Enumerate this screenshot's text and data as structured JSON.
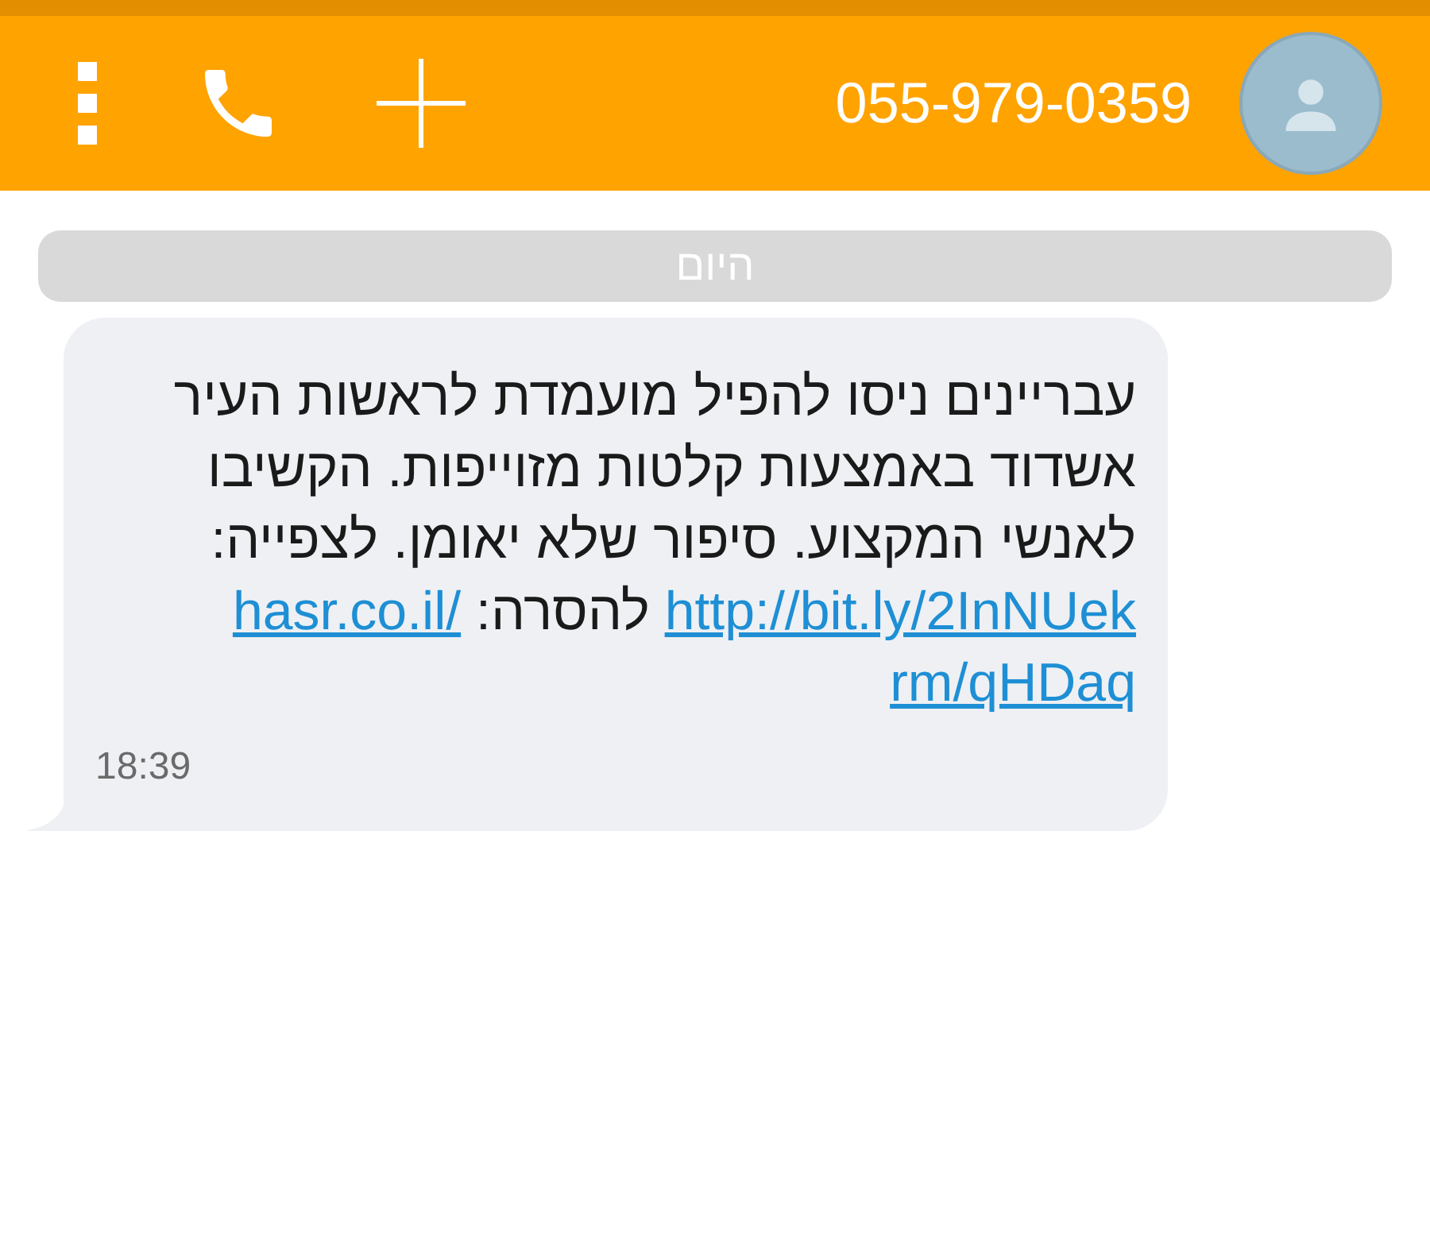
{
  "header": {
    "contact": "055-979-0359"
  },
  "date_divider": "היום",
  "messages": [
    {
      "lines": [
        [
          {
            "kind": "text",
            "text": "עבריינים ניסו להפיל מועמדת לראשות העיר"
          }
        ],
        [
          {
            "kind": "text",
            "text": "אשדוד באמצעות קלטות מזוייפות. הקשיבו"
          }
        ],
        [
          {
            "kind": "text",
            "text": "לאנשי המקצוע. סיפור שלא יאומן. לצפייה:"
          }
        ],
        [
          {
            "kind": "link",
            "text": "http://bit.ly/2InNUek"
          },
          {
            "kind": "text",
            "text": "להסרה:"
          },
          {
            "kind": "link",
            "text": "hasr.co.il/"
          }
        ],
        [
          {
            "kind": "link",
            "text": "rm/qHDaq"
          }
        ]
      ],
      "time": "18:39"
    }
  ]
}
